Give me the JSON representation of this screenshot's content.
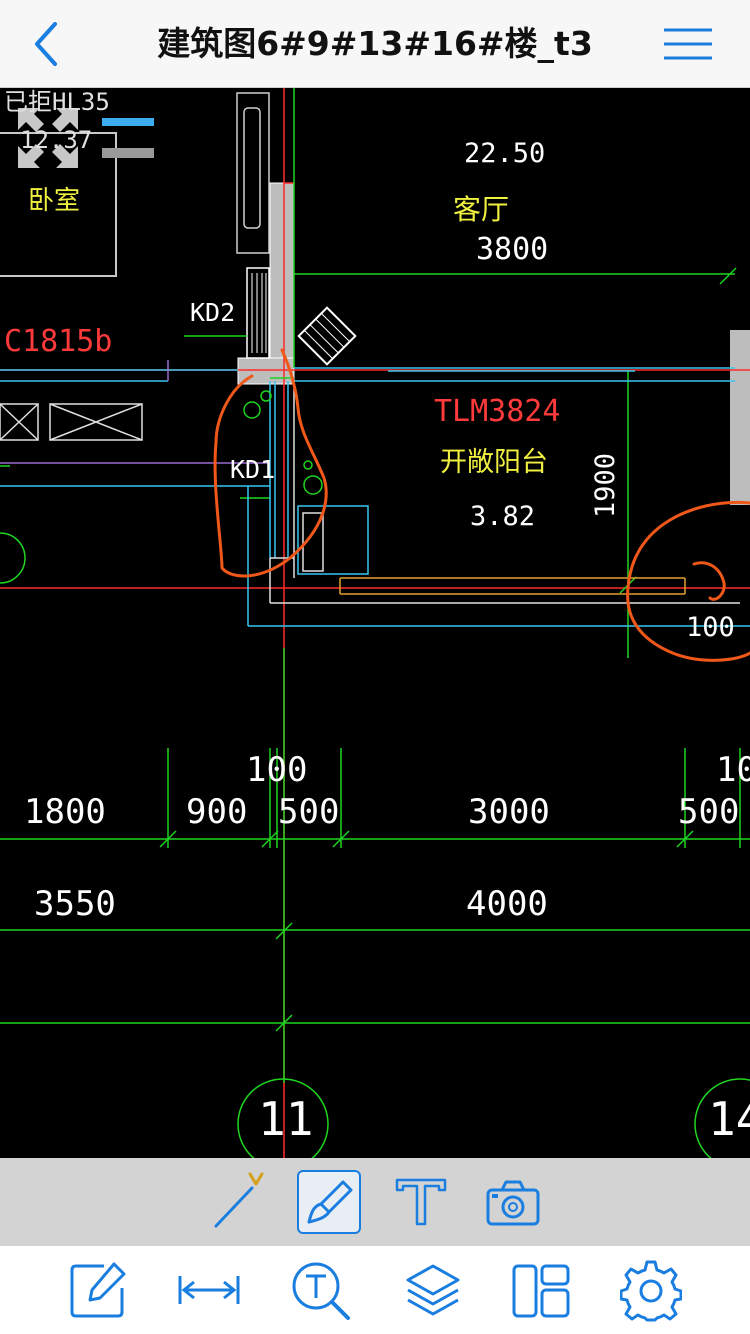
{
  "navbar": {
    "title": "建筑图6#9#13#16#楼_t3",
    "back_icon": "chevron-left-icon",
    "menu_icon": "hamburger-menu-icon"
  },
  "drawing": {
    "room_labels": {
      "bedroom_area_frag": "已拒HL35",
      "bedroom_area_value": "12.37",
      "bedroom_name": "卧室",
      "living_area": "22.50",
      "living_name": "客厅",
      "balcony_code": "TLM3824",
      "balcony_name": "开敞阳台",
      "balcony_area": "3.82"
    },
    "tags": {
      "window_code": "C1815b",
      "kd2": "KD2",
      "kd1": "KD1"
    },
    "dimensions": {
      "living_width": "3800",
      "balcony_depth": "1900",
      "right_100": "100",
      "row1_top": "100",
      "row1_top_right": "10",
      "row1": [
        "1800",
        "900",
        "500",
        "3000",
        "500"
      ],
      "row2": [
        "3550",
        "4000"
      ]
    },
    "grid_axes": [
      "11",
      "14"
    ]
  },
  "toolbar_top": {
    "tools": [
      {
        "name": "line-tool",
        "icon": "line-v-icon"
      },
      {
        "name": "brush-tool",
        "icon": "brush-icon",
        "active": true
      },
      {
        "name": "text-tool",
        "icon": "text-t-icon"
      },
      {
        "name": "camera-tool",
        "icon": "camera-icon"
      }
    ]
  },
  "toolbar_bottom": {
    "tools": [
      {
        "name": "annotate-tool",
        "icon": "edit-pencil-icon"
      },
      {
        "name": "measure-tool",
        "icon": "measure-arrow-icon"
      },
      {
        "name": "text-search-tool",
        "icon": "text-search-icon"
      },
      {
        "name": "layers-tool",
        "icon": "layers-icon"
      },
      {
        "name": "layout-tool",
        "icon": "layout-icon"
      },
      {
        "name": "settings-tool",
        "icon": "gear-icon"
      }
    ]
  },
  "colors": {
    "accent": "#1a7ee0",
    "cad_background": "#000000",
    "cad_green": "#1fd51f",
    "cad_red": "#ff2a2a",
    "cad_cyan": "#38c6f0",
    "cad_yellow": "#f0f040",
    "markup_orange": "#f0581a",
    "accent_gold": "#d4a017"
  }
}
